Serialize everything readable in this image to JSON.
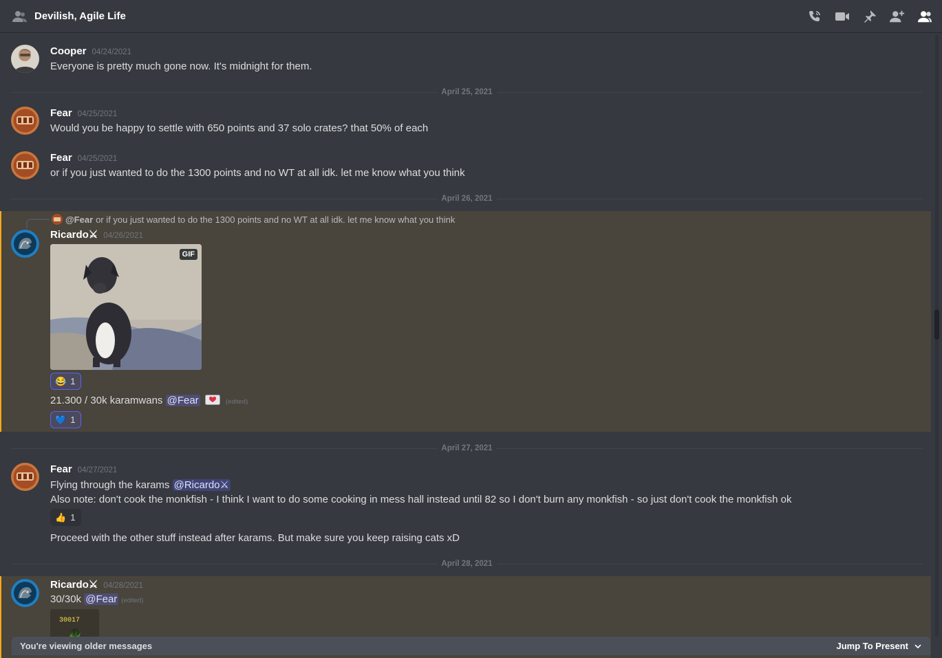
{
  "header": {
    "title": "Devilish, Agile Life",
    "icons": [
      "dm-group-icon",
      "call-icon",
      "video-icon",
      "pin-icon",
      "add-user-icon",
      "members-icon"
    ]
  },
  "colors": {
    "background": "#36393f",
    "mention_highlight": "#49443c",
    "mention_bar": "#faa81a",
    "blurple": "#5865f2"
  },
  "messages": [
    {
      "author": "Cooper",
      "timestamp": "04/24/2021",
      "text": "Everyone is pretty much gone now. It's midnight for them."
    },
    {
      "author": "Fear",
      "timestamp": "04/25/2021",
      "text": "Would you be happy to settle with 650 points and 37 solo crates? that 50% of each"
    },
    {
      "author": "Fear",
      "timestamp": "04/25/2021",
      "text": "or if you just wanted to do the 1300 points and no WT at all idk. let me know what you think"
    },
    {
      "author": "Ricardo⚔",
      "timestamp": "04/26/2021",
      "reply": {
        "name": "@Fear",
        "text": "or if you just wanted to do the 1300 points and no WT at all idk. let me know what you think"
      },
      "gif_badge": "GIF",
      "reaction1": {
        "emoji": "😂",
        "count": "1"
      },
      "text2": "21.300 /  30k karamwans ",
      "text2_mention": "@Fear",
      "edited": "(edited)",
      "reaction2": {
        "emoji": "💙",
        "count": "1"
      }
    },
    {
      "author": "Fear",
      "timestamp": "04/27/2021",
      "text": "Flying through the karams ",
      "mention": "@Ricardo⚔",
      "text_line2": "Also note: don't cook the monkfish - I think I want to do some cooking in mess hall instead until 82 so I don't burn any monkfish - so just don't cook the monkfish ok",
      "reaction": {
        "emoji": "👍",
        "count": "1"
      },
      "text_line3": "Proceed with the other stuff instead after karams. But make sure you keep raising cats xD"
    },
    {
      "author": "Ricardo⚔",
      "timestamp": "04/28/2021",
      "text": "30/30k ",
      "mention": "@Fear",
      "edited": "(edited)",
      "thumb_text": "30017"
    }
  ],
  "dividers": [
    "April 25, 2021",
    "April 26, 2021",
    "April 27, 2021",
    "April 28, 2021"
  ],
  "banner": {
    "text": "You're viewing older messages",
    "jump": "Jump To Present"
  }
}
